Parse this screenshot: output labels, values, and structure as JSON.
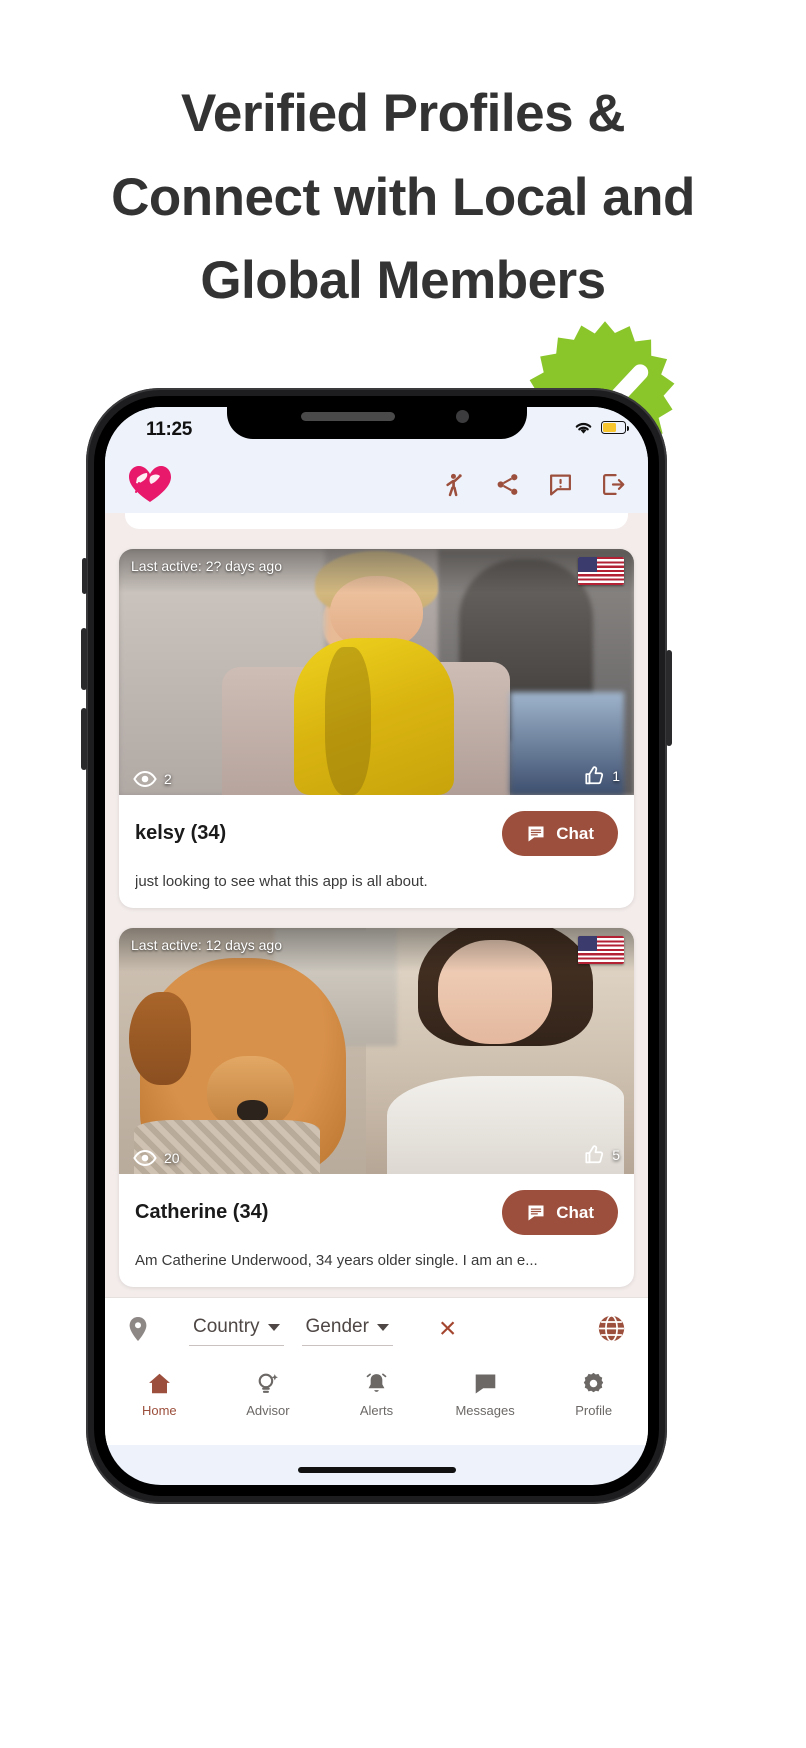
{
  "headline": {
    "line1": "Verified Profiles &",
    "line2": "Connect with Local and",
    "line3": "Global Members"
  },
  "badge": {
    "name": "verified-check-badge",
    "color": "#8ac62a"
  },
  "colors": {
    "accent_brown": "#9c4f3c",
    "logo_pink": "#e8196b",
    "screen_bg": "#eef3fb",
    "feed_bg": "#f3eceb"
  },
  "statusbar": {
    "time": "11:25",
    "wifi_icon": "wifi-icon",
    "battery_icon": "battery-icon"
  },
  "appheader": {
    "logo_icon": "heart-hands-logo",
    "actions": [
      {
        "icon": "person-waving-icon",
        "name": "wave-button"
      },
      {
        "icon": "share-icon",
        "name": "share-button"
      },
      {
        "icon": "feedback-alert-icon",
        "name": "feedback-button"
      },
      {
        "icon": "logout-icon",
        "name": "logout-button"
      }
    ]
  },
  "feed": {
    "cards": [
      {
        "last_active": "Last active: 2? days ago",
        "flag": "us-flag",
        "views": "2",
        "likes": "1",
        "name": "kelsy (34)",
        "chat_label": "Chat",
        "bio": "just looking to see what this app is all about."
      },
      {
        "last_active": "Last active: 12 days ago",
        "flag": "us-flag",
        "views": "20",
        "likes": "5",
        "name": "Catherine  (34)",
        "chat_label": "Chat",
        "bio": "Am Catherine Underwood, 34 years older single. I am an e..."
      }
    ]
  },
  "filterbar": {
    "location_icon": "location-pin-icon",
    "country_label": "Country",
    "gender_label": "Gender",
    "clear_label": "×",
    "globe_icon": "globe-icon"
  },
  "navbar": {
    "items": [
      {
        "label": "Home",
        "icon": "home-icon",
        "active": true
      },
      {
        "label": "Advisor",
        "icon": "advisor-bulb-icon",
        "active": false
      },
      {
        "label": "Alerts",
        "icon": "bell-icon",
        "active": false
      },
      {
        "label": "Messages",
        "icon": "message-icon",
        "active": false
      },
      {
        "label": "Profile",
        "icon": "gear-icon",
        "active": false
      }
    ]
  }
}
